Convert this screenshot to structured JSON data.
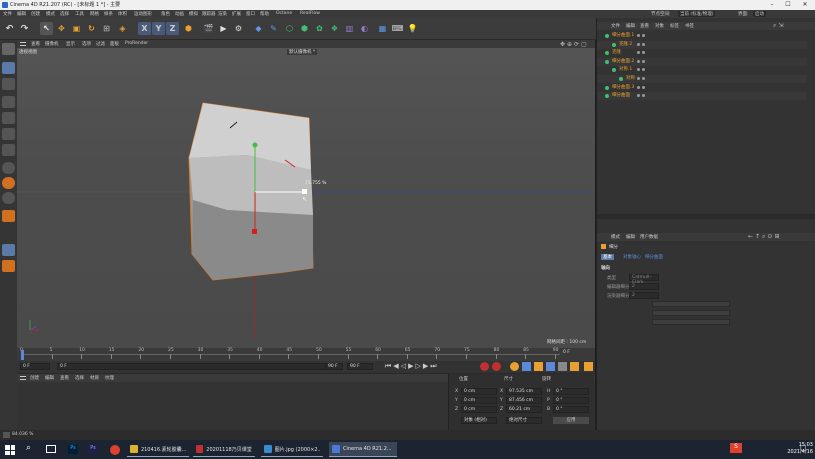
{
  "window": {
    "title": "Cinema 4D R21.207 (RC) - [未标题 1 *] - 主要"
  },
  "menubar": {
    "items": [
      "文件",
      "编辑",
      "创建",
      "模式",
      "选择",
      "工具",
      "网格",
      "样条",
      "体积",
      "运动图形",
      "角色",
      "动画",
      "模拟",
      "跟踪器",
      "渲染",
      "扩展",
      "窗口",
      "帮助",
      "Octane",
      "RealFlow"
    ],
    "right_items": [
      "节点空间:",
      "当前 (标准/物理)",
      "界面:",
      "启动"
    ]
  },
  "viewport": {
    "menu": [
      "查看",
      "摄像机",
      "显示",
      "选项",
      "过滤",
      "面板",
      "ProRender"
    ],
    "label": "透视视图",
    "camera_label": "默认摄像机 *",
    "scale_readout": "71.755 %",
    "grid_info": "网格间距 : 100 cm"
  },
  "timeline": {
    "ticks": [
      "0",
      "5",
      "10",
      "15",
      "20",
      "25",
      "30",
      "35",
      "40",
      "45",
      "50",
      "55",
      "60",
      "65",
      "70",
      "75",
      "80",
      "85",
      "90"
    ],
    "end_frame": "0 F",
    "start_field": "0 F",
    "current_field": "0 F",
    "end_field": "90 F",
    "end_field2": "90 F"
  },
  "bottom_left": {
    "menu": [
      "创建",
      "编辑",
      "查看",
      "选择",
      "材质",
      "纹理"
    ]
  },
  "coords": {
    "headers": [
      "位置",
      "尺寸",
      "旋转"
    ],
    "rows": [
      {
        "axis": "X",
        "pos": "0 cm",
        "size_axis": "X",
        "size": "97.535 cm",
        "rot_axis": "H",
        "rot": "0 °"
      },
      {
        "axis": "Y",
        "pos": "0 cm",
        "size_axis": "Y",
        "size": "87.456 cm",
        "rot_axis": "P",
        "rot": "0 °"
      },
      {
        "axis": "Z",
        "pos": "0 cm",
        "size_axis": "Z",
        "size": "60.21 cm",
        "rot_axis": "B",
        "rot": "0 °"
      }
    ],
    "mode1": "对象 (相对)",
    "mode2": "绝对尺寸",
    "apply": "应用"
  },
  "status": {
    "zoom": "84.036 %"
  },
  "objects": {
    "menu": [
      "文件",
      "编辑",
      "查看",
      "对象",
      "标签",
      "书签"
    ],
    "rows": [
      {
        "name": "细分曲面.1",
        "indent": 0,
        "selected": false
      },
      {
        "name": "克隆.2",
        "indent": 1,
        "selected": false
      },
      {
        "name": "克隆",
        "indent": 0,
        "selected": false
      },
      {
        "name": "细分曲面.2",
        "indent": 0,
        "selected": false
      },
      {
        "name": "对称.1",
        "indent": 1,
        "selected": false
      },
      {
        "name": "对称",
        "indent": 2,
        "selected": false
      },
      {
        "name": "细分曲面.3",
        "indent": 0,
        "selected": false
      },
      {
        "name": "细分曲面",
        "indent": 0,
        "selected": false
      }
    ]
  },
  "attributes": {
    "menu": [
      "模式",
      "编辑",
      "用户数据"
    ],
    "object_name": "细分",
    "tabs": [
      "基本",
      "对象轴心",
      "细分曲面"
    ],
    "section": "轴向",
    "fields": [
      {
        "label": "类型",
        "value": "Catmull-Clark"
      },
      {
        "label": "编辑器细分",
        "value": "2"
      },
      {
        "label": "渲染器细分",
        "value": "2"
      }
    ]
  },
  "taskbar": {
    "apps": [
      {
        "label": "210416.素轮胶囊...",
        "color": "#e0b030"
      },
      {
        "label": "20201118乃贝课堂...",
        "color": "#c03030"
      },
      {
        "label": "图片.jpg (2000×2...",
        "color": "#3a8ad0"
      },
      {
        "label": "Cinema 4D R21.2...",
        "color": "#4a7ad8"
      }
    ],
    "time": "15:03",
    "date": "2021/4/16"
  },
  "colors": {
    "accent": "#5a8ad8",
    "selection": "#e08020"
  }
}
